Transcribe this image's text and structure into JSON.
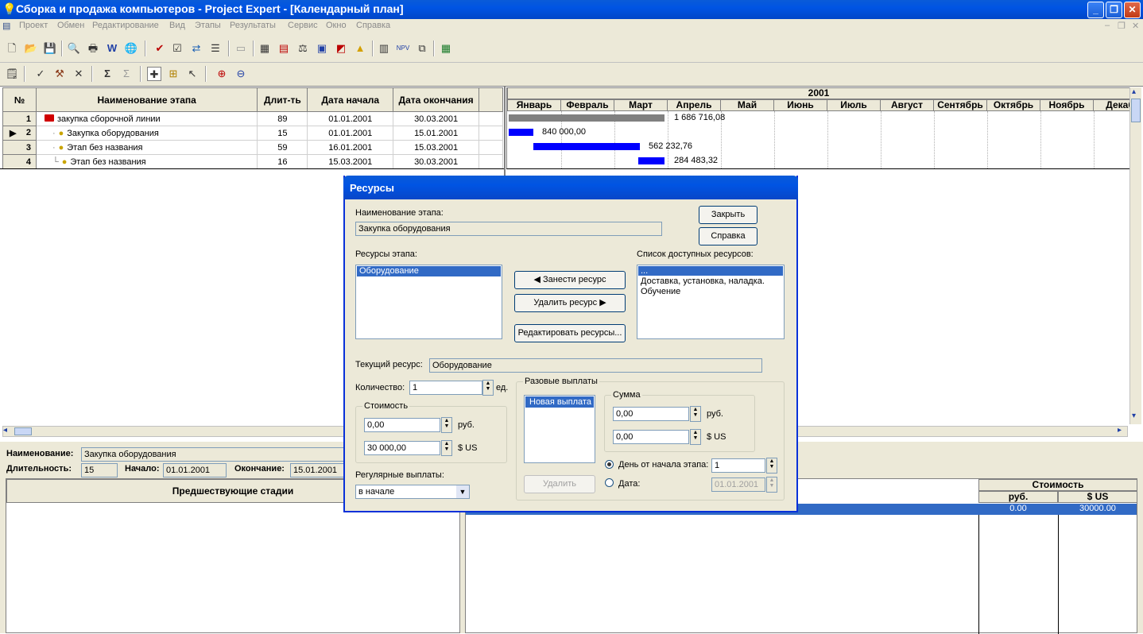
{
  "window": {
    "title": "Сборка и продажа компьютеров - Project Expert - [Календарный план]",
    "btn_min": "_",
    "btn_max": "❐",
    "btn_close": "✕"
  },
  "menu": [
    "Проект",
    "Обмен",
    "Редактирование",
    "Вид",
    "Этапы",
    "Результаты",
    "Сервис",
    "Окно",
    "Справка"
  ],
  "stages": {
    "headers": {
      "num": "№",
      "name": "Наименование этапа",
      "dur": "Длит-ть",
      "start": "Дата начала",
      "end": "Дата окончания"
    },
    "rows": [
      {
        "num": "1",
        "name": "закупка сборочной линии",
        "dur": "89",
        "start": "01.01.2001",
        "end": "30.03.2001"
      },
      {
        "num": "2",
        "name": "Закупка оборудования",
        "dur": "15",
        "start": "01.01.2001",
        "end": "15.01.2001"
      },
      {
        "num": "3",
        "name": "Этап без названия",
        "dur": "59",
        "start": "16.01.2001",
        "end": "15.03.2001"
      },
      {
        "num": "4",
        "name": "Этап без названия",
        "dur": "16",
        "start": "15.03.2001",
        "end": "30.03.2001"
      }
    ]
  },
  "gantt": {
    "year": "2001",
    "months": [
      "Январь",
      "Февраль",
      "Март",
      "Апрель",
      "Май",
      "Июнь",
      "Июль",
      "Август",
      "Сентябрь",
      "Октябрь",
      "Ноябрь",
      "Декаб"
    ],
    "bars": [
      {
        "label": "1 686 716,08",
        "color": "#808080"
      },
      {
        "label": "840 000,00",
        "color": "#0000ff"
      },
      {
        "label": "562 232,76",
        "color": "#0000ff"
      },
      {
        "label": "284 483,32",
        "color": "#0000ff"
      }
    ]
  },
  "dialog": {
    "title": "Ресурсы",
    "stage_name_label": "Наименование этапа:",
    "stage_name_value": "Закупка оборудования",
    "close_btn": "Закрыть",
    "help_btn": "Справка",
    "stage_resources_label": "Ресурсы этапа:",
    "stage_resources": [
      "Оборудование"
    ],
    "available_label": "Список доступных ресурсов:",
    "available": [
      "...",
      "Доставка, установка, наладка.",
      "Обучение"
    ],
    "add_btn": "Занести ресурс",
    "remove_btn": "Удалить ресурс",
    "edit_btn": "Редактировать ресурсы...",
    "current_label": "Текущий ресурс:",
    "current_value": "Оборудование",
    "qty_label": "Количество:",
    "qty_value": "1",
    "qty_unit": "ед.",
    "cost_group": "Стоимость",
    "cost_rub": "0,00",
    "cost_rub_unit": "руб.",
    "cost_usd": "30 000,00",
    "cost_usd_unit": "$ US",
    "regular_label": "Регулярные выплаты:",
    "regular_value": "в начале",
    "oneoff_group": "Разовые выплаты",
    "oneoff_list": [
      "Новая выплата"
    ],
    "delete_btn": "Удалить",
    "sum_group": "Сумма",
    "sum_rub": "0,00",
    "sum_rub_unit": "руб.",
    "sum_usd": "0,00",
    "sum_usd_unit": "$ US",
    "radio_day": "День от начала этапа:",
    "radio_day_value": "1",
    "radio_date": "Дата:",
    "radio_date_value": "01.01.2001"
  },
  "detail": {
    "name_label": "Наименование:",
    "name_value": "Закупка оборудования",
    "dur_label": "Длительность:",
    "dur_value": "15",
    "start_label": "Начало:",
    "start_value": "01.01.2001",
    "end_label": "Окончание:",
    "end_value": "15.01.2001",
    "pred_header": "Предшествующие стадии",
    "cost_header": "Стоимость",
    "rub_header": "руб.",
    "usd_header": "$ US",
    "row_rub": "0.00",
    "row_usd": "30000.00"
  }
}
